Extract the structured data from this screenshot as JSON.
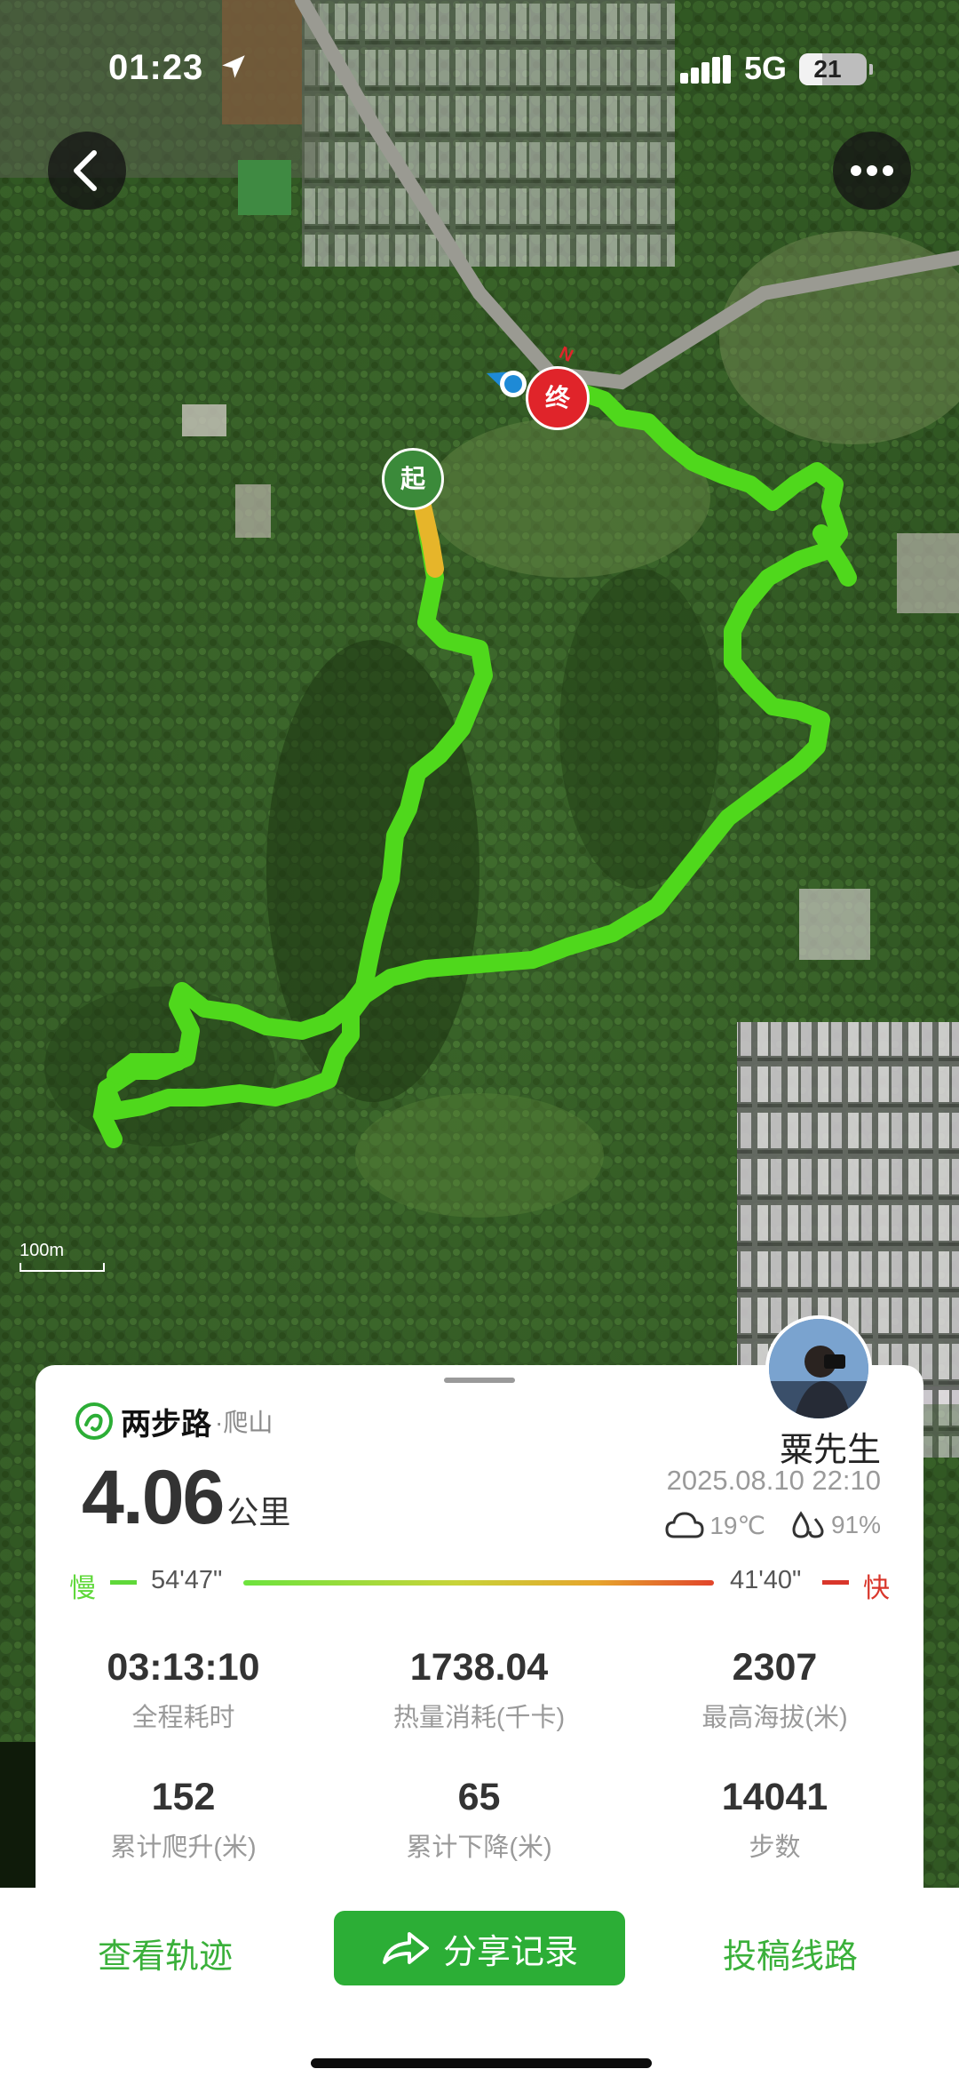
{
  "status_bar": {
    "time": "01:23",
    "network": "5G",
    "battery": "21"
  },
  "map": {
    "start_marker": "起",
    "end_marker": "终",
    "north_label": "N",
    "scale_label": "100m"
  },
  "card": {
    "brand": "两步路",
    "category": "·爬山",
    "distance_value": "4.06",
    "distance_unit": "公里",
    "username": "粟先生",
    "datetime": "2025.08.10 22:10",
    "temperature": "19℃",
    "humidity": "91%",
    "pace": {
      "slow_label": "慢",
      "slow_time": "54'47\"",
      "fast_time": "41'40\"",
      "fast_label": "快"
    },
    "stats": [
      {
        "value": "03:13:10",
        "label": "全程耗时"
      },
      {
        "value": "1738.04",
        "label": "热量消耗(千卡)"
      },
      {
        "value": "2307",
        "label": "最高海拔(米)"
      },
      {
        "value": "152",
        "label": "累计爬升(米)"
      },
      {
        "value": "65",
        "label": "累计下降(米)"
      },
      {
        "value": "14041",
        "label": "步数"
      }
    ]
  },
  "bottom_bar": {
    "view_track": "查看轨迹",
    "share": "分享记录",
    "submit_route": "投稿线路"
  },
  "colors": {
    "accent_green": "#2cae36",
    "slow_green": "#5fd83a",
    "fast_red": "#d9362b",
    "track_green": "#5be324"
  }
}
